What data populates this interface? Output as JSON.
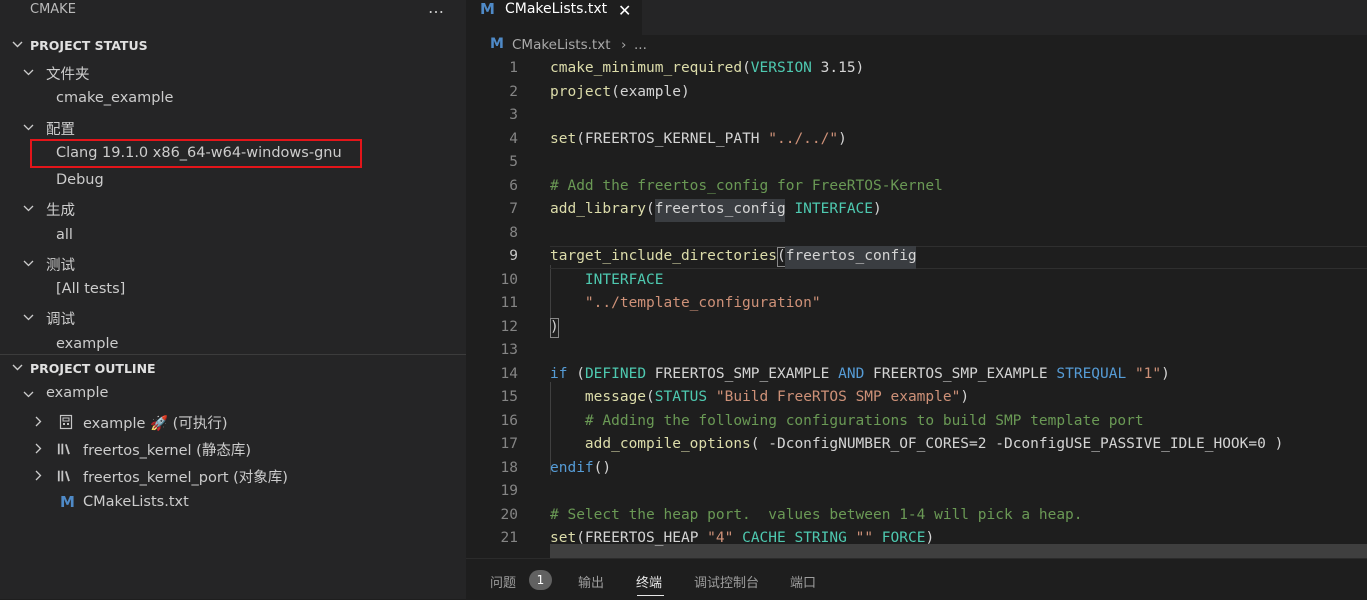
{
  "sidebar": {
    "title": "CMAKE",
    "more_icon": "…",
    "project_status": {
      "header": "PROJECT STATUS",
      "groups": [
        {
          "label": "文件夹",
          "children": [
            "cmake_example"
          ]
        },
        {
          "label": "配置",
          "children": [
            "Clang 19.1.0 x86_64-w64-windows-gnu",
            "Debug"
          ]
        },
        {
          "label": "生成",
          "children": [
            "all"
          ]
        },
        {
          "label": "测试",
          "children": [
            "[All tests]"
          ]
        },
        {
          "label": "调试",
          "children": [
            "example"
          ]
        }
      ]
    },
    "project_outline": {
      "header": "PROJECT OUTLINE",
      "root": "example",
      "targets": [
        {
          "label": "example 🚀 (可执行)",
          "icon": "executable-icon"
        },
        {
          "label": "freertos_kernel (静态库)",
          "icon": "library-icon"
        },
        {
          "label": "freertos_kernel_port (对象库)",
          "icon": "library-icon"
        }
      ],
      "file": {
        "label": "CMakeLists.txt",
        "icon_letter": "M"
      }
    }
  },
  "editor": {
    "tab": {
      "icon_letter": "M",
      "label": "CMakeLists.txt",
      "close": "✕"
    },
    "breadcrumb": {
      "icon_letter": "M",
      "file": "CMakeLists.txt",
      "sep": "›",
      "more": "..."
    },
    "active_line": 9,
    "lines": [
      {
        "n": "1",
        "tokens": [
          [
            "fn",
            "cmake_minimum_required"
          ],
          [
            "tx",
            "("
          ],
          [
            "ty",
            "VERSION"
          ],
          [
            "tx",
            " 3.15)"
          ]
        ]
      },
      {
        "n": "2",
        "tokens": [
          [
            "fn",
            "project"
          ],
          [
            "tx",
            "(example)"
          ]
        ]
      },
      {
        "n": "3",
        "tokens": []
      },
      {
        "n": "4",
        "tokens": [
          [
            "fn",
            "set"
          ],
          [
            "tx",
            "(FREERTOS_KERNEL_PATH "
          ],
          [
            "str",
            "\"../../\""
          ],
          [
            "tx",
            ")"
          ]
        ]
      },
      {
        "n": "5",
        "tokens": []
      },
      {
        "n": "6",
        "tokens": [
          [
            "cm",
            "# Add the freertos_config for FreeRTOS-Kernel"
          ]
        ]
      },
      {
        "n": "7",
        "tokens": [
          [
            "fn",
            "add_library"
          ],
          [
            "tx",
            "(freertos_config "
          ],
          [
            "ty",
            "INTERFACE"
          ],
          [
            "tx",
            ")"
          ]
        ]
      },
      {
        "n": "8",
        "tokens": []
      },
      {
        "n": "9",
        "tokens": [
          [
            "fn",
            "target_include_directories"
          ],
          [
            "tx",
            "(freertos_config"
          ]
        ]
      },
      {
        "n": "10",
        "tokens": [
          [
            "tx",
            "    "
          ],
          [
            "ty",
            "INTERFACE"
          ]
        ]
      },
      {
        "n": "11",
        "tokens": [
          [
            "tx",
            "    "
          ],
          [
            "str",
            "\"../template_configuration\""
          ]
        ]
      },
      {
        "n": "12",
        "tokens": [
          [
            "tx",
            ")"
          ]
        ]
      },
      {
        "n": "13",
        "tokens": []
      },
      {
        "n": "14",
        "tokens": [
          [
            "kw",
            "if"
          ],
          [
            "tx",
            " ("
          ],
          [
            "ty",
            "DEFINED"
          ],
          [
            "tx",
            " FREERTOS_SMP_EXAMPLE "
          ],
          [
            "kw",
            "AND"
          ],
          [
            "tx",
            " FREERTOS_SMP_EXAMPLE "
          ],
          [
            "kw",
            "STREQUAL"
          ],
          [
            "tx",
            " "
          ],
          [
            "str",
            "\"1\""
          ],
          [
            "tx",
            ")"
          ]
        ]
      },
      {
        "n": "15",
        "tokens": [
          [
            "tx",
            "    "
          ],
          [
            "fn",
            "message"
          ],
          [
            "tx",
            "("
          ],
          [
            "ty",
            "STATUS"
          ],
          [
            "tx",
            " "
          ],
          [
            "str",
            "\"Build FreeRTOS SMP example\""
          ],
          [
            "tx",
            ")"
          ]
        ]
      },
      {
        "n": "16",
        "tokens": [
          [
            "tx",
            "    "
          ],
          [
            "cm",
            "# Adding the following configurations to build SMP template port"
          ]
        ]
      },
      {
        "n": "17",
        "tokens": [
          [
            "tx",
            "    "
          ],
          [
            "fn",
            "add_compile_options"
          ],
          [
            "tx",
            "( -DconfigNUMBER_OF_CORES=2 -DconfigUSE_PASSIVE_IDLE_HOOK=0 )"
          ]
        ]
      },
      {
        "n": "18",
        "tokens": [
          [
            "kw",
            "endif"
          ],
          [
            "tx",
            "()"
          ]
        ]
      },
      {
        "n": "19",
        "tokens": []
      },
      {
        "n": "20",
        "tokens": [
          [
            "cm",
            "# Select the heap port.  values between 1-4 will pick a heap."
          ]
        ]
      },
      {
        "n": "21",
        "tokens": [
          [
            "fn",
            "set"
          ],
          [
            "tx",
            "(FREERTOS_HEAP "
          ],
          [
            "str",
            "\"4\""
          ],
          [
            "tx",
            " "
          ],
          [
            "ty",
            "CACHE STRING"
          ],
          [
            "tx",
            " "
          ],
          [
            "str",
            "\"\""
          ],
          [
            "tx",
            " "
          ],
          [
            "ty",
            "FORCE"
          ],
          [
            "tx",
            ")"
          ]
        ]
      }
    ]
  },
  "panel": {
    "tabs": [
      "问题",
      "输出",
      "终端",
      "调试控制台",
      "端口"
    ],
    "active_tab": "终端",
    "problems_count": "1"
  },
  "colors": {
    "highlight_border": "#e3151a",
    "cmake_icon": "#4f8ac7",
    "function": "#dcdcaa",
    "keyword": "#569cd6",
    "type": "#4ec9b0",
    "string": "#ce9178",
    "comment": "#6a9955"
  }
}
